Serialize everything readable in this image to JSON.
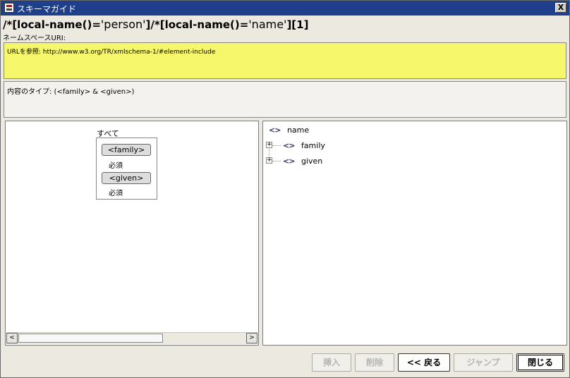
{
  "window": {
    "title": "スキーマガイド",
    "close_label": "X"
  },
  "xpath": {
    "parts": [
      "/*[local-name()=",
      "'person'",
      "]/*[local-name()=",
      "'name'",
      "][1]"
    ]
  },
  "namespace": {
    "label": "ネームスペースURI:"
  },
  "url_panel": {
    "text": "URLを参照: http://www.w3.org/TR/xmlschema-1/#element-include",
    "background": "#f7f76c"
  },
  "type_panel": {
    "text": "内容のタイプ: (<family> & <given>)"
  },
  "diagram": {
    "compositor_label": "すべて",
    "elements": [
      {
        "label": "<family>",
        "occurrence": "必須"
      },
      {
        "label": "<given>",
        "occurrence": "必須"
      }
    ]
  },
  "tree": {
    "root": {
      "icon": "element-icon",
      "label": "name"
    },
    "children": [
      {
        "icon": "element-icon",
        "label": "family",
        "expander": "+"
      },
      {
        "icon": "element-icon",
        "label": "given",
        "expander": "+"
      }
    ]
  },
  "scrollbar": {
    "left_arrow": "<",
    "right_arrow": ">"
  },
  "buttons": {
    "insert": "挿入",
    "delete": "削除",
    "back": "<< 戻る",
    "jump": "ジャンプ",
    "close": "閉じる"
  },
  "colors": {
    "titlebar": "#1f3f8a",
    "url_panel": "#f7f76c"
  }
}
